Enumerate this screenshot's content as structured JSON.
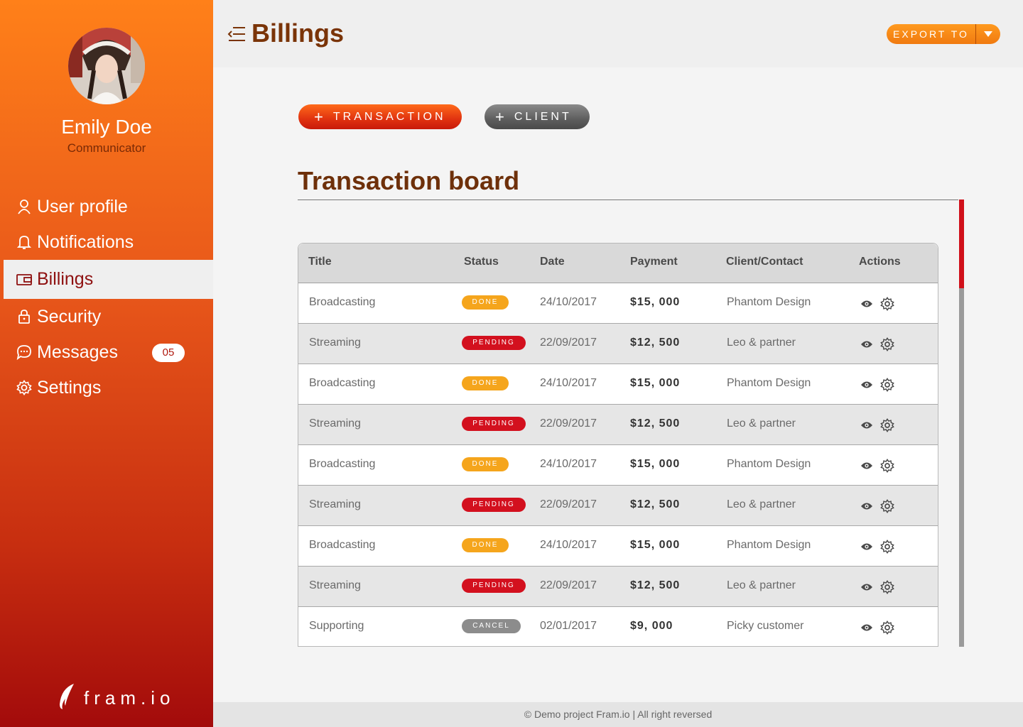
{
  "user": {
    "name": "Emily Doe",
    "role": "Communicator"
  },
  "sidebar": {
    "items": [
      {
        "label": "User profile",
        "icon": "user-icon"
      },
      {
        "label": "Notifications",
        "icon": "bell-icon"
      },
      {
        "label": "Billings",
        "icon": "wallet-icon",
        "active": true
      },
      {
        "label": "Security",
        "icon": "lock-icon"
      },
      {
        "label": "Messages",
        "icon": "chat-icon",
        "badge": "05"
      },
      {
        "label": "Settings",
        "icon": "gear-icon"
      }
    ]
  },
  "brand": {
    "name": "fram.io"
  },
  "header": {
    "title": "Billings",
    "export_label": "EXPORT TO"
  },
  "actions": {
    "transaction_label": "TRANSACTION",
    "client_label": "CLIENT"
  },
  "board": {
    "title": "Transaction board",
    "columns": [
      "Title",
      "Status",
      "Date",
      "Payment",
      "Client/Contact",
      "Actions"
    ],
    "rows": [
      {
        "title": "Broadcasting",
        "status": "DONE",
        "date": "24/10/2017",
        "payment": "$15, 000",
        "client": "Phantom Design"
      },
      {
        "title": "Streaming",
        "status": "PENDING",
        "date": "22/09/2017",
        "payment": "$12, 500",
        "client": "Leo & partner"
      },
      {
        "title": "Broadcasting",
        "status": "DONE",
        "date": "24/10/2017",
        "payment": "$15, 000",
        "client": "Phantom Design"
      },
      {
        "title": "Streaming",
        "status": "PENDING",
        "date": "22/09/2017",
        "payment": "$12, 500",
        "client": "Leo & partner"
      },
      {
        "title": "Broadcasting",
        "status": "DONE",
        "date": "24/10/2017",
        "payment": "$15, 000",
        "client": "Phantom Design"
      },
      {
        "title": "Streaming",
        "status": "PENDING",
        "date": "22/09/2017",
        "payment": "$12, 500",
        "client": "Leo & partner"
      },
      {
        "title": "Broadcasting",
        "status": "DONE",
        "date": "24/10/2017",
        "payment": "$15, 000",
        "client": "Phantom Design"
      },
      {
        "title": "Streaming",
        "status": "PENDING",
        "date": "22/09/2017",
        "payment": "$12, 500",
        "client": "Leo & partner"
      },
      {
        "title": "Supporting",
        "status": "CANCEL",
        "date": "02/01/2017",
        "payment": "$9, 000",
        "client": "Picky customer"
      }
    ]
  },
  "footer": {
    "text": "© Demo project Fram.io | All right reversed"
  },
  "colors": {
    "accent": "#f07a10",
    "done": "#f5a51c",
    "pending": "#d3101e",
    "cancel": "#8c8c8c",
    "title": "#7a3408"
  }
}
